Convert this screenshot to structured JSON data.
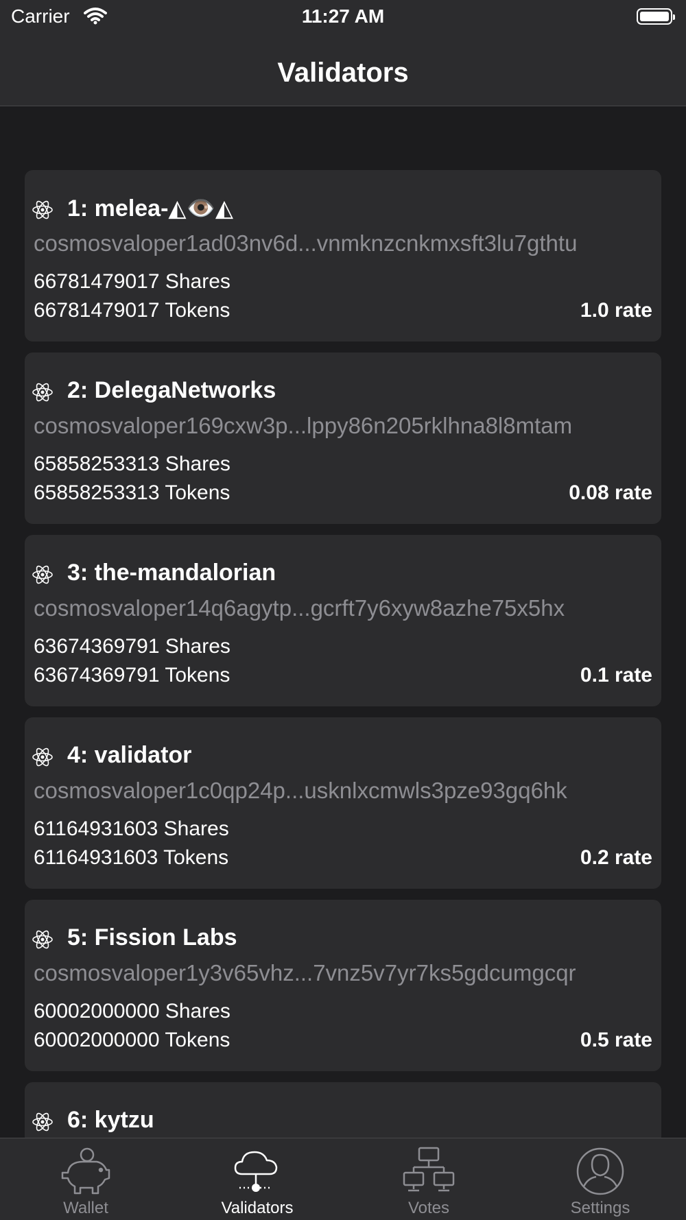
{
  "status_bar": {
    "carrier": "Carrier",
    "time": "11:27 AM"
  },
  "nav": {
    "title": "Validators"
  },
  "validators": [
    {
      "title": "1: melea-◭👁️◭",
      "address": "cosmosvaloper1ad03nv6d...vnmknzcnkmxsft3lu7gthtu",
      "shares": "66781479017 Shares",
      "tokens": "66781479017 Tokens",
      "rate": "1.0 rate"
    },
    {
      "title": "2: DelegaNetworks",
      "address": "cosmosvaloper169cxw3p...lppy86n205rklhna8l8mtam",
      "shares": "65858253313 Shares",
      "tokens": "65858253313 Tokens",
      "rate": "0.08 rate"
    },
    {
      "title": "3: the-mandalorian",
      "address": "cosmosvaloper14q6agytp...gcrft7y6xyw8azhe75x5hx",
      "shares": "63674369791 Shares",
      "tokens": "63674369791 Tokens",
      "rate": "0.1 rate"
    },
    {
      "title": "4: validator",
      "address": "cosmosvaloper1c0qp24p...usknlxcmwls3pze93gq6hk",
      "shares": "61164931603 Shares",
      "tokens": "61164931603 Tokens",
      "rate": "0.2 rate"
    },
    {
      "title": "5: Fission Labs",
      "address": "cosmosvaloper1y3v65vhz...7vnz5v7yr7ks5gdcumgcqr",
      "shares": "60002000000 Shares",
      "tokens": "60002000000 Tokens",
      "rate": "0.5 rate"
    },
    {
      "title": "6: kytzu",
      "address": "",
      "shares": "",
      "tokens": "",
      "rate": ""
    }
  ],
  "tabs": [
    {
      "label": "Wallet",
      "icon": "piggy-bank-icon",
      "active": false
    },
    {
      "label": "Validators",
      "icon": "cloud-network-icon",
      "active": true
    },
    {
      "label": "Votes",
      "icon": "network-computers-icon",
      "active": false
    },
    {
      "label": "Settings",
      "icon": "user-circle-icon",
      "active": false
    }
  ],
  "colors": {
    "background": "#1c1c1e",
    "card": "#2c2c2e",
    "secondary_text": "#8e8e93",
    "primary_text": "#ffffff"
  }
}
